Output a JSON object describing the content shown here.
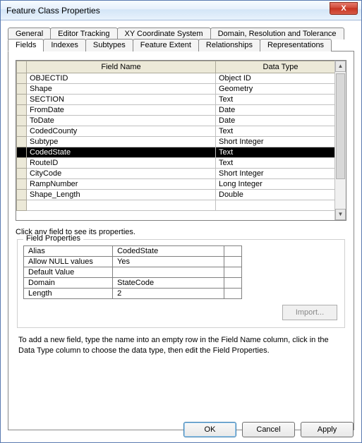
{
  "window": {
    "title": "Feature Class Properties",
    "close_label": "X"
  },
  "tabs_row1": {
    "general": "General",
    "editor_tracking": "Editor Tracking",
    "xy_coord": "XY Coordinate System",
    "domain_res": "Domain, Resolution and Tolerance"
  },
  "tabs_row2": {
    "fields": "Fields",
    "indexes": "Indexes",
    "subtypes": "Subtypes",
    "feature_extent": "Feature Extent",
    "relationships": "Relationships",
    "representations": "Representations"
  },
  "fieldtable": {
    "header_fieldname": "Field Name",
    "header_datatype": "Data Type",
    "rows": [
      {
        "name": "OBJECTID",
        "type": "Object ID"
      },
      {
        "name": "Shape",
        "type": "Geometry"
      },
      {
        "name": "SECTION",
        "type": "Text"
      },
      {
        "name": "FromDate",
        "type": "Date"
      },
      {
        "name": "ToDate",
        "type": "Date"
      },
      {
        "name": "CodedCounty",
        "type": "Text"
      },
      {
        "name": "Subtype",
        "type": "Short Integer"
      },
      {
        "name": "CodedState",
        "type": "Text"
      },
      {
        "name": "RouteID",
        "type": "Text"
      },
      {
        "name": "CityCode",
        "type": "Short Integer"
      },
      {
        "name": "RampNumber",
        "type": "Long Integer"
      },
      {
        "name": "Shape_Length",
        "type": "Double"
      }
    ],
    "selected_index": 7
  },
  "helptext": "Click any field to see its properties.",
  "fieldprops": {
    "legend": "Field Properties",
    "rows": {
      "alias_label": "Alias",
      "alias_value": "CodedState",
      "allownull_label": "Allow NULL values",
      "allownull_value": "Yes",
      "default_label": "Default Value",
      "default_value": "",
      "domain_label": "Domain",
      "domain_value": "StateCode",
      "length_label": "Length",
      "length_value": "2"
    },
    "import_label": "Import..."
  },
  "hint2": "To add a new field, type the name into an empty row in the Field Name column, click in the Data Type column to choose the data type, then edit the Field Properties.",
  "buttons": {
    "ok": "OK",
    "cancel": "Cancel",
    "apply": "Apply"
  }
}
